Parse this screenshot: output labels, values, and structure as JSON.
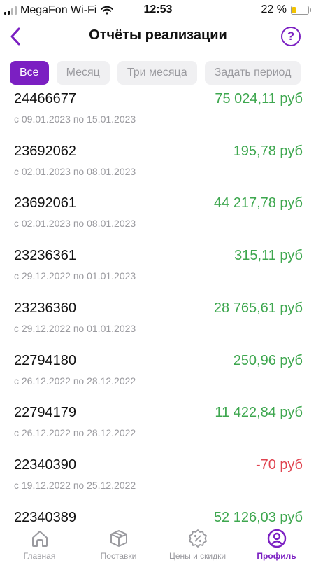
{
  "status_bar": {
    "carrier": "MegaFon Wi-Fi",
    "time": "12:53",
    "battery": "22 %",
    "battery_level": 0.22
  },
  "header": {
    "title": "Отчёты реализации",
    "back_icon": "chevron-left-icon",
    "help_icon": "question-circle-icon",
    "help_label": "?"
  },
  "filters": [
    {
      "label": "Все",
      "active": true
    },
    {
      "label": "Месяц",
      "active": false
    },
    {
      "label": "Три месяца",
      "active": false
    },
    {
      "label": "Задать период",
      "active": false
    }
  ],
  "reports": [
    {
      "id": "24466677",
      "period": "с 09.01.2023 по 15.01.2023",
      "amount": "75 024,11 руб",
      "negative": false
    },
    {
      "id": "23692062",
      "period": "с 02.01.2023 по 08.01.2023",
      "amount": "195,78 руб",
      "negative": false
    },
    {
      "id": "23692061",
      "period": "с 02.01.2023 по 08.01.2023",
      "amount": "44 217,78 руб",
      "negative": false
    },
    {
      "id": "23236361",
      "period": "с 29.12.2022 по 01.01.2023",
      "amount": "315,11 руб",
      "negative": false
    },
    {
      "id": "23236360",
      "period": "с 29.12.2022 по 01.01.2023",
      "amount": "28 765,61 руб",
      "negative": false
    },
    {
      "id": "22794180",
      "period": "с 26.12.2022 по 28.12.2022",
      "amount": "250,96 руб",
      "negative": false
    },
    {
      "id": "22794179",
      "period": "с 26.12.2022 по 28.12.2022",
      "amount": "11 422,84 руб",
      "negative": false
    },
    {
      "id": "22340390",
      "period": "с 19.12.2022 по 25.12.2022",
      "amount": "-70 руб",
      "negative": true
    },
    {
      "id": "22340389",
      "period": "",
      "amount": "52 126,03 руб",
      "negative": false
    }
  ],
  "tabbar": [
    {
      "label": "Главная",
      "icon": "home-icon",
      "active": false
    },
    {
      "label": "Поставки",
      "icon": "box-icon",
      "active": false
    },
    {
      "label": "Цены и скидки",
      "icon": "discount-badge-icon",
      "active": false
    },
    {
      "label": "Профиль",
      "icon": "profile-icon",
      "active": true
    }
  ],
  "colors": {
    "accent": "#7b1fc2",
    "positive": "#3ea74f",
    "negative": "#e0434f",
    "muted": "#9a9a9f"
  }
}
